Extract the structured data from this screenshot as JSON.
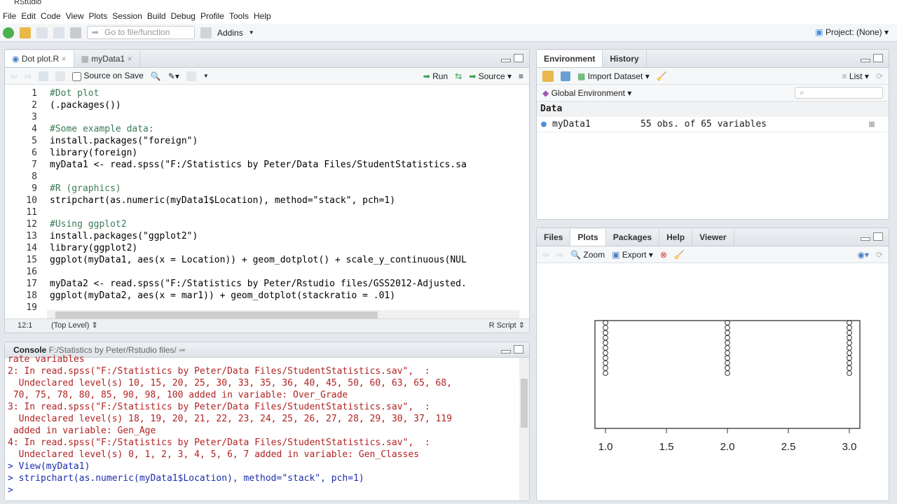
{
  "app": {
    "title": "RStudio"
  },
  "menu": [
    "File",
    "Edit",
    "Code",
    "View",
    "Plots",
    "Session",
    "Build",
    "Debug",
    "Profile",
    "Tools",
    "Help"
  ],
  "toolbar": {
    "goto_placeholder": "Go to file/function",
    "addins": "Addins",
    "project": "Project: (None)"
  },
  "source": {
    "tabs": [
      {
        "label": "Dot plot.R",
        "active": true
      },
      {
        "label": "myData1",
        "active": false
      }
    ],
    "source_on_save": "Source on Save",
    "run": "Run",
    "source_btn": "Source",
    "lines": [
      [
        "1",
        "#Dot plot"
      ],
      [
        "2",
        "(.packages())"
      ],
      [
        "3",
        ""
      ],
      [
        "4",
        "#Some example data:"
      ],
      [
        "5",
        "install.packages(\"foreign\")"
      ],
      [
        "6",
        "library(foreign)"
      ],
      [
        "7",
        "myData1 <- read.spss(\"F:/Statistics by Peter/Data Files/StudentStatistics.sa"
      ],
      [
        "8",
        ""
      ],
      [
        "9",
        "#R (graphics)"
      ],
      [
        "10",
        "stripchart(as.numeric(myData1$Location), method=\"stack\", pch=1)"
      ],
      [
        "11",
        ""
      ],
      [
        "12",
        "#Using ggplot2"
      ],
      [
        "13",
        "install.packages(\"ggplot2\")"
      ],
      [
        "14",
        "library(ggplot2)"
      ],
      [
        "15",
        "ggplot(myData1, aes(x = Location)) + geom_dotplot() + scale_y_continuous(NUL"
      ],
      [
        "16",
        ""
      ],
      [
        "17",
        "myData2 <- read.spss(\"F:/Statistics by Peter/Rstudio files/GSS2012-Adjusted."
      ],
      [
        "18",
        "ggplot(myData2, aes(x = mar1)) + geom_dotplot(stackratio = .01)"
      ],
      [
        "19",
        ""
      ]
    ],
    "status": {
      "position": "12:1",
      "scope": "(Top Level)",
      "type": "R Script"
    }
  },
  "console": {
    "title": "Console",
    "path": "F:/Statistics by Peter/Rstudio files/",
    "output": [
      "rate variables",
      "2: In read.spss(\"F:/Statistics by Peter/Data Files/StudentStatistics.sav\",  :",
      "  Undeclared level(s) 10, 15, 20, 25, 30, 33, 35, 36, 40, 45, 50, 60, 63, 65, 68,",
      " 70, 75, 78, 80, 85, 90, 98, 100 added in variable: Over_Grade",
      "3: In read.spss(\"F:/Statistics by Peter/Data Files/StudentStatistics.sav\",  :",
      "  Undeclared level(s) 18, 19, 20, 21, 22, 23, 24, 25, 26, 27, 28, 29, 30, 37, 119",
      " added in variable: Gen_Age",
      "4: In read.spss(\"F:/Statistics by Peter/Data Files/StudentStatistics.sav\",  :",
      "  Undeclared level(s) 0, 1, 2, 3, 4, 5, 6, 7 added in variable: Gen_Classes"
    ],
    "commands": [
      "> View(myData1)",
      "> stripchart(as.numeric(myData1$Location), method=\"stack\", pch=1)",
      ">"
    ]
  },
  "environment": {
    "tabs": [
      "Environment",
      "History"
    ],
    "import": "Import Dataset",
    "view": "List",
    "scope": "Global Environment",
    "section": "Data",
    "rows": [
      {
        "name": "myData1",
        "value": "55 obs. of 65 variables"
      }
    ]
  },
  "plots": {
    "tabs": [
      "Files",
      "Plots",
      "Packages",
      "Help",
      "Viewer"
    ],
    "zoom": "Zoom",
    "export": "Export"
  },
  "chart_data": {
    "type": "scatter",
    "title": "",
    "xlabel": "",
    "ylabel": "",
    "x_ticks": [
      "1.0",
      "1.5",
      "2.0",
      "2.5",
      "3.0"
    ],
    "xlim": [
      1,
      3
    ],
    "stacks": [
      {
        "x": 1,
        "visible_points": 11
      },
      {
        "x": 2,
        "visible_points": 11
      },
      {
        "x": 3,
        "visible_points": 11
      }
    ],
    "marker": "open-circle",
    "grid": false
  }
}
